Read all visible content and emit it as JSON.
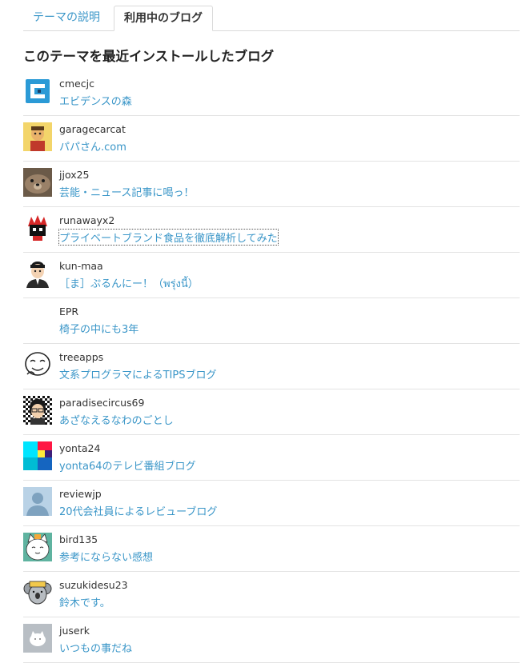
{
  "tabs": [
    {
      "label": "テーマの説明",
      "active": false
    },
    {
      "label": "利用中のブログ",
      "active": true
    }
  ],
  "heading": "このテーマを最近インストールしたブログ",
  "blogs": [
    {
      "user": "cmecjc",
      "title": "エビデンスの森",
      "avatar": "logo-square-icon"
    },
    {
      "user": "garagecarcat",
      "title": "パパさん.com",
      "avatar": "character-avatar"
    },
    {
      "user": "jjox25",
      "title": "芸能・ニュース記事に喝っ！",
      "avatar": "otter-avatar"
    },
    {
      "user": "runawayx2",
      "title": "プライベートブランド食品を徹底解析してみた",
      "avatar": "character-avatar"
    },
    {
      "user": "kun-maa",
      "title": "［ま］ぷるんにー！（พรุ่งนี้）",
      "avatar": "person-avatar"
    },
    {
      "user": "EPR",
      "title": "椅子の中にも3年",
      "avatar": "blank-avatar"
    },
    {
      "user": "treeapps",
      "title": "文系プログラマによるTIPSブログ",
      "avatar": "face-avatar"
    },
    {
      "user": "paradisecircus69",
      "title": "あざなえるなわのごとし",
      "avatar": "person-avatar"
    },
    {
      "user": "yonta24",
      "title": "yonta64のテレビ番組ブログ",
      "avatar": "color-block-avatar"
    },
    {
      "user": "reviewjp",
      "title": "20代会社員によるレビューブログ",
      "avatar": "default-user-avatar"
    },
    {
      "user": "bird135",
      "title": "参考にならない感想",
      "avatar": "cat-avatar"
    },
    {
      "user": "suzukidesu23",
      "title": "鈴木です。",
      "avatar": "koala-avatar"
    },
    {
      "user": "juserk",
      "title": "いつもの事だね",
      "avatar": "cat-avatar"
    }
  ]
}
